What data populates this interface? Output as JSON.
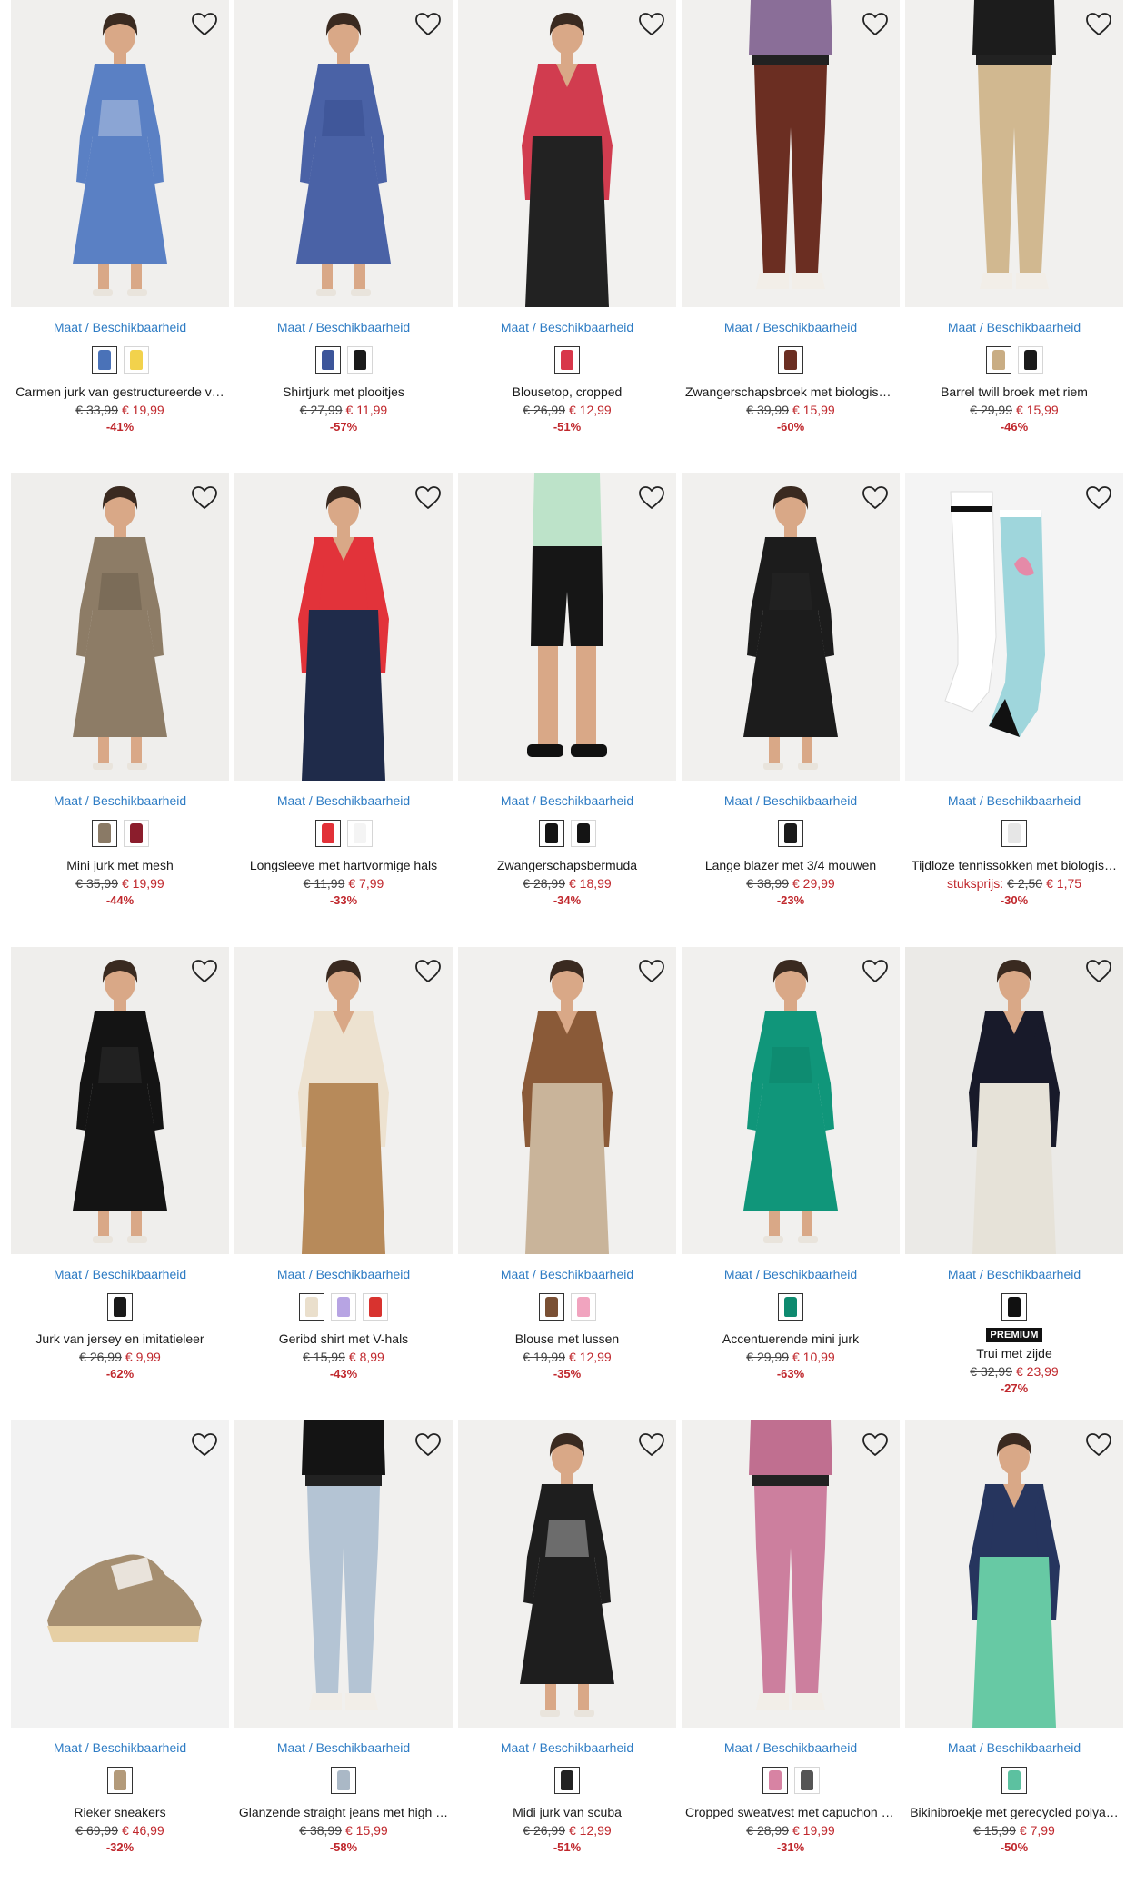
{
  "avail_label": "Maat / Beschikbaarheid",
  "products": [
    {
      "name": "Carmen jurk van gestructureerde v…",
      "old": "€ 33,99",
      "new": "€ 19,99",
      "discount": "-41%",
      "swatches": [
        "#4a72b8",
        "#f2d24c"
      ],
      "bg": "#f0efed",
      "fig": "dress",
      "c1": "#5a80c4",
      "c2": "#e8ecf4"
    },
    {
      "name": "Shirtjurk met plooitjes",
      "old": "€ 27,99",
      "new": "€ 11,99",
      "discount": "-57%",
      "swatches": [
        "#3c559a",
        "#1a1a1a"
      ],
      "bg": "#f1f0ee",
      "fig": "dress",
      "c1": "#4a62a6",
      "c2": "#2f4485"
    },
    {
      "name": "Blousetop, cropped",
      "old": "€ 26,99",
      "new": "€ 12,99",
      "discount": "-51%",
      "swatches": [
        "#d8374a"
      ],
      "bg": "#f2f1ef",
      "fig": "top",
      "c1": "#d13c4f",
      "c2": "#222222"
    },
    {
      "name": "Zwangerschapsbroek met biologisc…",
      "old": "€ 39,99",
      "new": "€ 15,99",
      "discount": "-60%",
      "swatches": [
        "#6b2e22"
      ],
      "bg": "#f1f0ee",
      "fig": "pants",
      "c1": "#6b2e22",
      "c2": "#8a6e98"
    },
    {
      "name": "Barrel twill broek met riem",
      "old": "€ 29,99",
      "new": "€ 15,99",
      "discount": "-46%",
      "swatches": [
        "#c9ad84",
        "#1a1a1a"
      ],
      "bg": "#f1f0ee",
      "fig": "pants",
      "c1": "#d1b890",
      "c2": "#1c1c1c"
    },
    {
      "name": "Mini jurk met mesh",
      "old": "€ 35,99",
      "new": "€ 19,99",
      "discount": "-44%",
      "swatches": [
        "#8a7a66",
        "#8b1d2c"
      ],
      "bg": "#efeeec",
      "fig": "dress",
      "c1": "#8d7c66",
      "c2": "#5d4f40"
    },
    {
      "name": "Longsleeve met hartvormige hals",
      "old": "€ 11,99",
      "new": "€ 7,99",
      "discount": "-33%",
      "swatches": [
        "#e23138",
        "#f4f4f4"
      ],
      "bg": "#f1f0ee",
      "fig": "top",
      "c1": "#e2333a",
      "c2": "#1f2b4a"
    },
    {
      "name": "Zwangerschapsbermuda",
      "old": "€ 28,99",
      "new": "€ 18,99",
      "discount": "-34%",
      "swatches": [
        "#141414",
        "#141414"
      ],
      "bg": "#f2f1ef",
      "fig": "shorts",
      "c1": "#161616",
      "c2": "#bde3c9"
    },
    {
      "name": "Lange blazer met 3/4 mouwen",
      "old": "€ 38,99",
      "new": "€ 29,99",
      "discount": "-23%",
      "swatches": [
        "#1a1a1a"
      ],
      "bg": "#f1f0ee",
      "fig": "dress",
      "c1": "#1c1c1c",
      "c2": "#2a2a2a"
    },
    {
      "name": "Tijdloze tennissokken met biologis…",
      "unit": "stuksprijs:",
      "old": "€ 2,50",
      "new": "€ 1,75",
      "discount": "-30%",
      "swatches": [
        "#e6e6e6"
      ],
      "bg": "#f4f4f4",
      "fig": "socks",
      "c1": "#ffffff",
      "c2": "#9fd6dc"
    },
    {
      "name": "Jurk van jersey en imitatieleer",
      "old": "€ 26,99",
      "new": "€ 9,99",
      "discount": "-62%",
      "swatches": [
        "#1a1a1a"
      ],
      "bg": "#efeeec",
      "fig": "dress",
      "c1": "#141414",
      "c2": "#3a3a3a"
    },
    {
      "name": "Geribd shirt met V-hals",
      "old": "€ 15,99",
      "new": "€ 8,99",
      "discount": "-43%",
      "swatches": [
        "#eadfcc",
        "#b7a4e3",
        "#d8332f"
      ],
      "bg": "#f1f0ee",
      "fig": "top",
      "c1": "#ede2d0",
      "c2": "#b78a5a"
    },
    {
      "name": "Blouse met lussen",
      "old": "€ 19,99",
      "new": "€ 12,99",
      "discount": "-35%",
      "swatches": [
        "#7a5034",
        "#f1a4bf"
      ],
      "bg": "#f1f0ee",
      "fig": "top",
      "c1": "#8a5a38",
      "c2": "#c9b49a"
    },
    {
      "name": "Accentuerende mini jurk",
      "old": "€ 29,99",
      "new": "€ 10,99",
      "discount": "-63%",
      "swatches": [
        "#0e8a6f"
      ],
      "bg": "#f1f0ee",
      "fig": "dress",
      "c1": "#10967a",
      "c2": "#0c7a62"
    },
    {
      "name": "Trui met zijde",
      "badge": "PREMIUM",
      "old": "€ 32,99",
      "new": "€ 23,99",
      "discount": "-27%",
      "swatches": [
        "#111111"
      ],
      "bg": "#ebeae7",
      "fig": "top",
      "c1": "#181a2a",
      "c2": "#e6e2d8"
    },
    {
      "name": "Rieker sneakers",
      "old": "€ 69,99",
      "new": "€ 46,99",
      "discount": "-32%",
      "swatches": [
        "#b39a7a"
      ],
      "bg": "#f2f2f2",
      "fig": "shoe",
      "c1": "#a58e70",
      "c2": "#e6cfa4"
    },
    {
      "name": "Glanzende straight jeans met high …",
      "old": "€ 38,99",
      "new": "€ 15,99",
      "discount": "-58%",
      "swatches": [
        "#aab8c6"
      ],
      "bg": "#f1f0ee",
      "fig": "pants",
      "c1": "#b4c4d4",
      "c2": "#141414"
    },
    {
      "name": "Midi jurk van scuba",
      "old": "€ 26,99",
      "new": "€ 12,99",
      "discount": "-51%",
      "swatches": [
        "#222222"
      ],
      "bg": "#f1f0ee",
      "fig": "dress",
      "c1": "#1e1e1e",
      "c2": "#ffffff"
    },
    {
      "name": "Cropped sweatvest met capuchon i…",
      "old": "€ 28,99",
      "new": "€ 19,99",
      "discount": "-31%",
      "swatches": [
        "#d783a3",
        "#555555"
      ],
      "bg": "#f1f0ee",
      "fig": "pants",
      "c1": "#cc7f9e",
      "c2": "#c06f90"
    },
    {
      "name": "Bikinibroekje met gerecycled polya…",
      "old": "€ 15,99",
      "new": "€ 7,99",
      "discount": "-50%",
      "swatches": [
        "#5cc1a0"
      ],
      "bg": "#f1f0ee",
      "fig": "top",
      "c1": "#26355e",
      "c2": "#67c9a4"
    }
  ]
}
